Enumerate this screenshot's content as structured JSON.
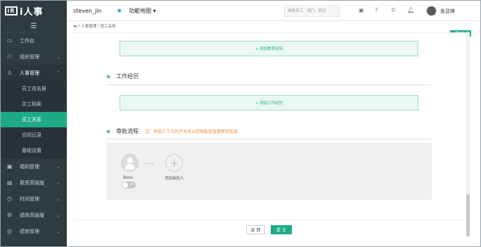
{
  "sidebar": {
    "logo": "i人事",
    "collapse_icon": "hamburger-icon",
    "items": [
      {
        "label": "工作台",
        "icon": "monitor-icon",
        "has_arrow": false
      },
      {
        "label": "组织管理",
        "icon": "org-chart-icon",
        "has_arrow": true
      },
      {
        "label": "人事管理",
        "icon": "person-icon",
        "has_arrow": true,
        "open": true
      },
      {
        "label": "福利管理",
        "icon": "gift-icon",
        "has_arrow": true
      },
      {
        "label": "薪资高级版",
        "icon": "wallet-icon",
        "has_arrow": true
      },
      {
        "label": "时间管理",
        "icon": "clock-icon",
        "has_arrow": true
      },
      {
        "label": "绩效高级版",
        "icon": "gear-icon",
        "has_arrow": true
      },
      {
        "label": "绩效管理",
        "icon": "target-icon",
        "has_arrow": true
      }
    ],
    "sub_items": [
      {
        "label": "员工花名册",
        "active": false
      },
      {
        "label": "员工档案",
        "active": false
      },
      {
        "label": "员工关系",
        "active": true
      },
      {
        "label": "合同记录",
        "active": false
      },
      {
        "label": "基础设置",
        "active": false
      }
    ]
  },
  "topbar": {
    "user": "steven_jin",
    "feature_map": "功能地图",
    "search_placeholder": "搜索员工、部门、职位",
    "account_name": "金显锋"
  },
  "breadcrumb": {
    "parent": "人事管理",
    "current": "员工关系",
    "separator": "/"
  },
  "expand_tag": "△展开全部",
  "content": {
    "add_education": "+ 添加教育经历",
    "work_title": "工作经历",
    "add_work": "+ 添加工作经历",
    "approval_title": "审批流程",
    "approval_note": "注：审批人下方的开关可以控制能否查看薪资信息",
    "boss_label": "Boss",
    "add_approver": "添加审批人",
    "toggle_mark": "×"
  },
  "footer": {
    "back": "返 回",
    "submit": "提 交"
  },
  "colors": {
    "accent": "#1dab86",
    "sidebar_bg": "#2e3b40",
    "note": "#f08a3e"
  }
}
